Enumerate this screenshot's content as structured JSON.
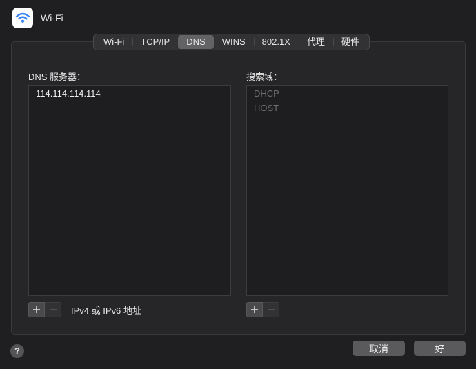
{
  "window": {
    "title": "Wi-Fi",
    "icon": "wifi-icon",
    "icon_color": "#3b82f6"
  },
  "tabs": [
    {
      "label": "Wi-Fi",
      "active": false
    },
    {
      "label": "TCP/IP",
      "active": false
    },
    {
      "label": "DNS",
      "active": true
    },
    {
      "label": "WINS",
      "active": false
    },
    {
      "label": "802.1X",
      "active": false
    },
    {
      "label": "代理",
      "active": false
    },
    {
      "label": "硬件",
      "active": false
    }
  ],
  "dns": {
    "label": "DNS 服务器：",
    "servers": [
      "114.114.114.114"
    ],
    "hint": "IPv4 或 IPv6 地址"
  },
  "search": {
    "label": "搜索域：",
    "domains": [
      "DHCP",
      "HOST"
    ]
  },
  "buttons": {
    "cancel": "取消",
    "ok": "好",
    "help": "?"
  }
}
